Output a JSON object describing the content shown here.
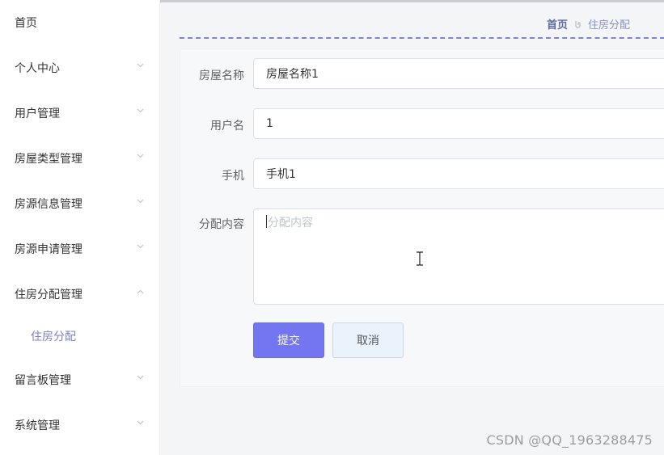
{
  "sidebar": {
    "items": [
      {
        "label": "首页",
        "has_chevron": false
      },
      {
        "label": "个人中心",
        "has_chevron": true
      },
      {
        "label": "用户管理",
        "has_chevron": true
      },
      {
        "label": "房屋类型管理",
        "has_chevron": true
      },
      {
        "label": "房源信息管理",
        "has_chevron": true
      },
      {
        "label": "房源申请管理",
        "has_chevron": true
      },
      {
        "label": "住房分配管理",
        "has_chevron": true,
        "expanded": true
      },
      {
        "label": "留言板管理",
        "has_chevron": true
      },
      {
        "label": "系统管理",
        "has_chevron": true
      }
    ],
    "subitem": {
      "label": "住房分配"
    }
  },
  "breadcrumb": {
    "home": "首页",
    "current": "住房分配"
  },
  "form": {
    "house_name": {
      "label": "房屋名称",
      "value": "房屋名称1"
    },
    "username": {
      "label": "用户名",
      "value": "1"
    },
    "phone": {
      "label": "手机",
      "value": "手机1"
    },
    "content": {
      "label": "分配内容",
      "placeholder": "分配内容"
    },
    "submit_label": "提交",
    "cancel_label": "取消"
  },
  "watermark": "CSDN @QQ_1963288475",
  "colors": {
    "accent": "#7475f0",
    "submenu_text": "#7b82c6",
    "cancel_bg": "#eaf2fc"
  }
}
